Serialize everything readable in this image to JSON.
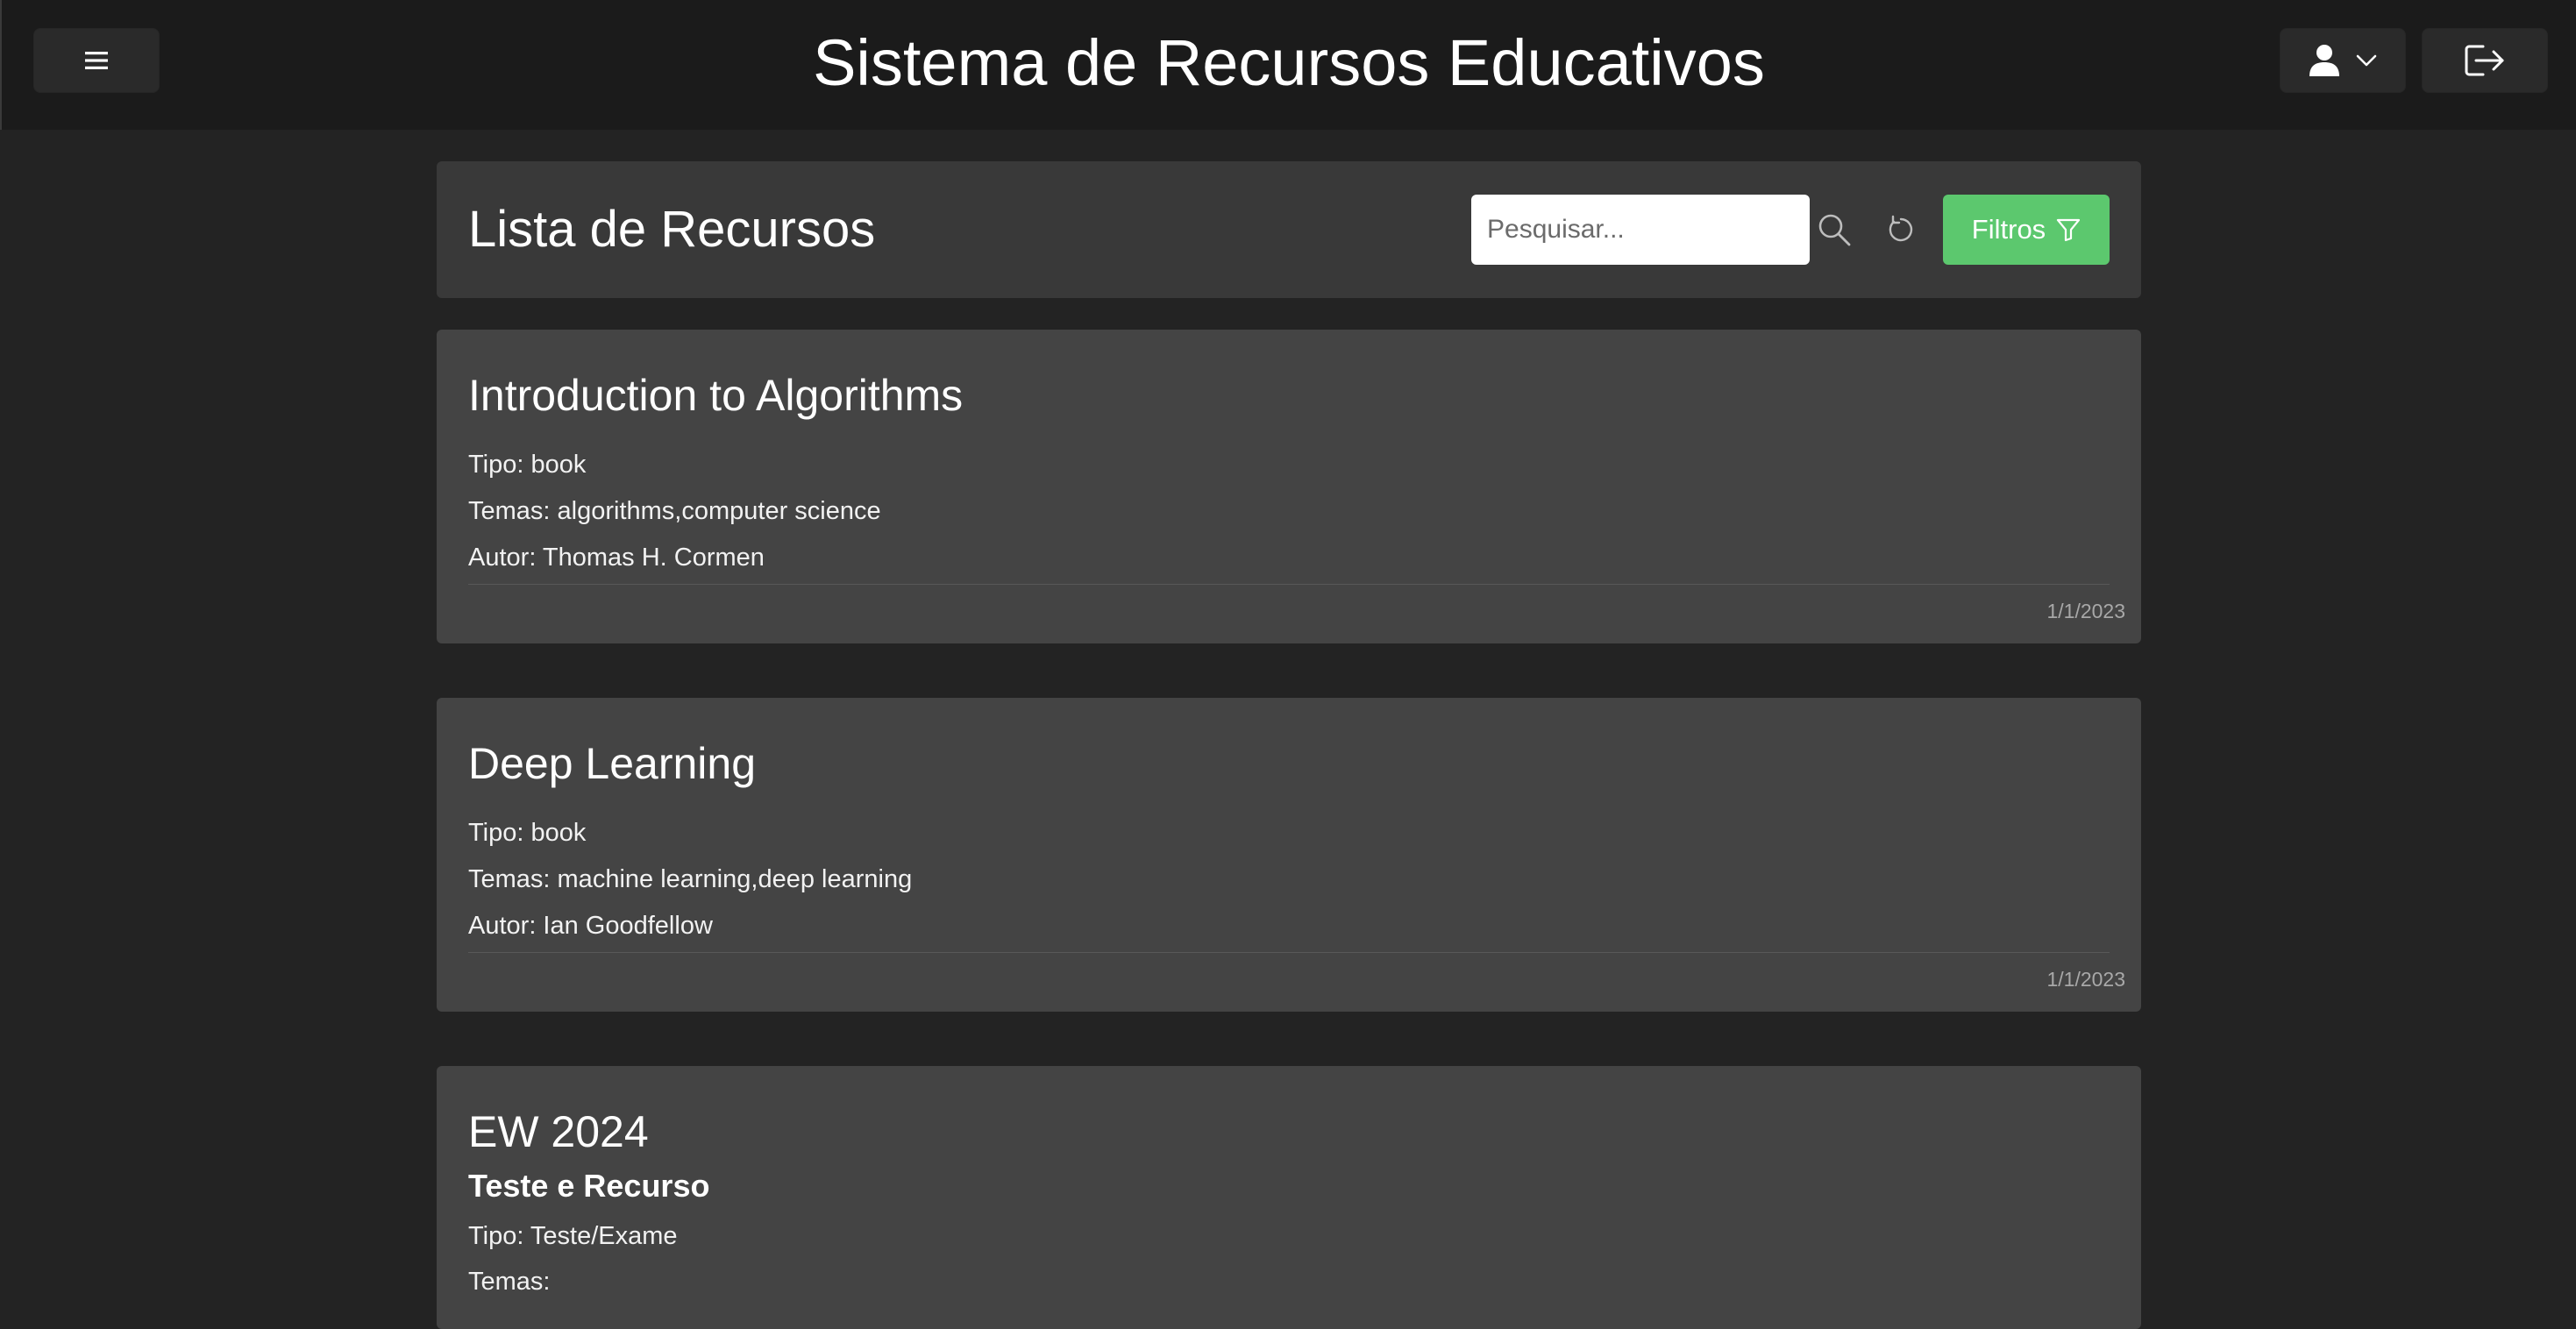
{
  "header": {
    "title": "Sistema de Recursos Educativos",
    "menu_icon": "hamburger-icon",
    "user_icon": "user-icon",
    "user_chevron_icon": "chevron-down-icon",
    "logout_icon": "logout-icon"
  },
  "list": {
    "title": "Lista de Recursos",
    "search_placeholder": "Pesquisar...",
    "search_icon": "search-icon",
    "reset_icon": "refresh-icon",
    "filter_label": "Filtros",
    "filter_icon": "filter-icon"
  },
  "resources": [
    {
      "title": "Introduction to Algorithms",
      "tipo": "Tipo: book",
      "temas": "Temas: algorithms,computer science",
      "autor": "Autor: Thomas H. Cormen",
      "date": "1/1/2023"
    },
    {
      "title": "Deep Learning",
      "tipo": "Tipo: book",
      "temas": "Temas: machine learning,deep learning",
      "autor": "Autor: Ian Goodfellow",
      "date": "1/1/2023"
    },
    {
      "title": "EW 2024",
      "subtitle": "Teste e Recurso",
      "tipo": "Tipo: Teste/Exame",
      "temas": "Temas:"
    }
  ],
  "colors": {
    "background": "#232323",
    "header": "#1b1b1b",
    "panel": "#393939",
    "card": "#444444",
    "accent_green": "#5cc86e"
  }
}
